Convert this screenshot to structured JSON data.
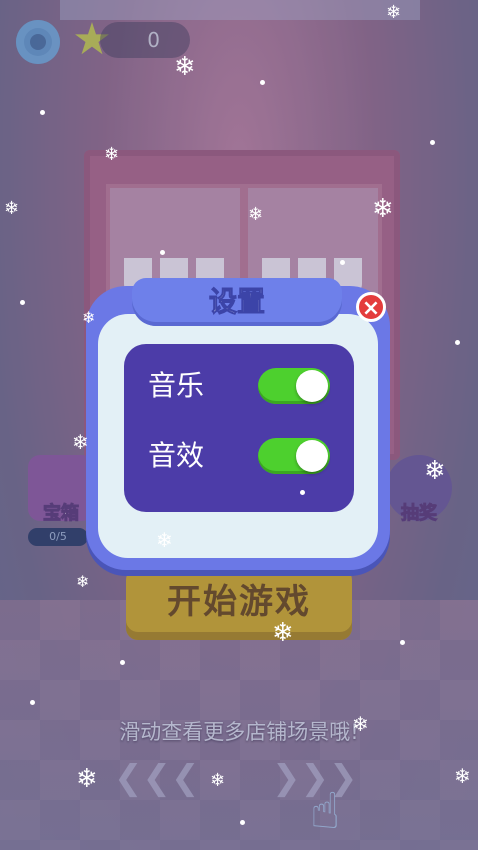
{
  "hud": {
    "coins": "0",
    "settings_icon": "gear-icon",
    "star_icon": "star-icon"
  },
  "side_buttons": {
    "chest_label": "宝箱",
    "chest_progress": "0/5",
    "lottery_label": "抽奖"
  },
  "start_button": {
    "label": "开始游戏"
  },
  "hint": "滑动查看更多店铺场景哦!",
  "dialog": {
    "title": "设置",
    "rows": [
      {
        "label": "音乐",
        "on": true
      },
      {
        "label": "音效",
        "on": true
      }
    ]
  },
  "colors": {
    "dialog": "#6b78e6",
    "panel": "#4c3ca8",
    "toggle_on": "#4dd02e",
    "close": "#e43c3c"
  }
}
